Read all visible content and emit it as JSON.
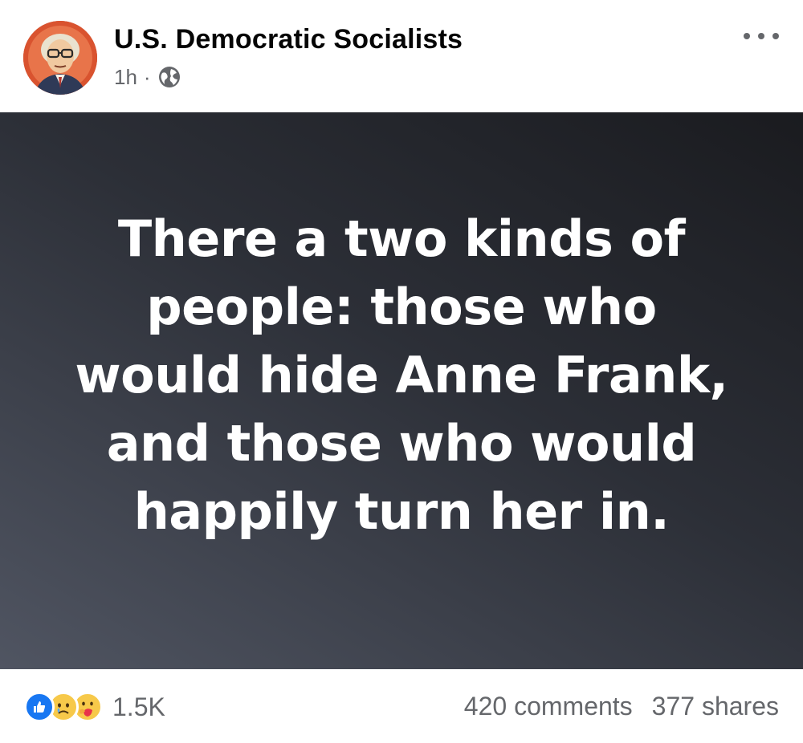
{
  "post": {
    "page_name": "U.S. Democratic Socialists",
    "time": "1h",
    "separator": "·",
    "privacy_icon": "globe-icon",
    "more_icon": "more-options-icon",
    "quote_lines": [
      "There a two kinds of",
      "people: those who",
      "would hide Anne Frank,",
      "and those who would",
      "happily turn her in."
    ]
  },
  "footer": {
    "reaction_icons": [
      "like-icon",
      "sad-icon",
      "care-icon"
    ],
    "reaction_count": "1.5K",
    "comments": "420 comments",
    "shares": "377 shares"
  },
  "colors": {
    "text_primary": "#050505",
    "text_secondary": "#65676b",
    "like_blue": "#1877f2",
    "emoji_yellow": "#f7c94a",
    "avatar_red": "#c94a2b"
  }
}
